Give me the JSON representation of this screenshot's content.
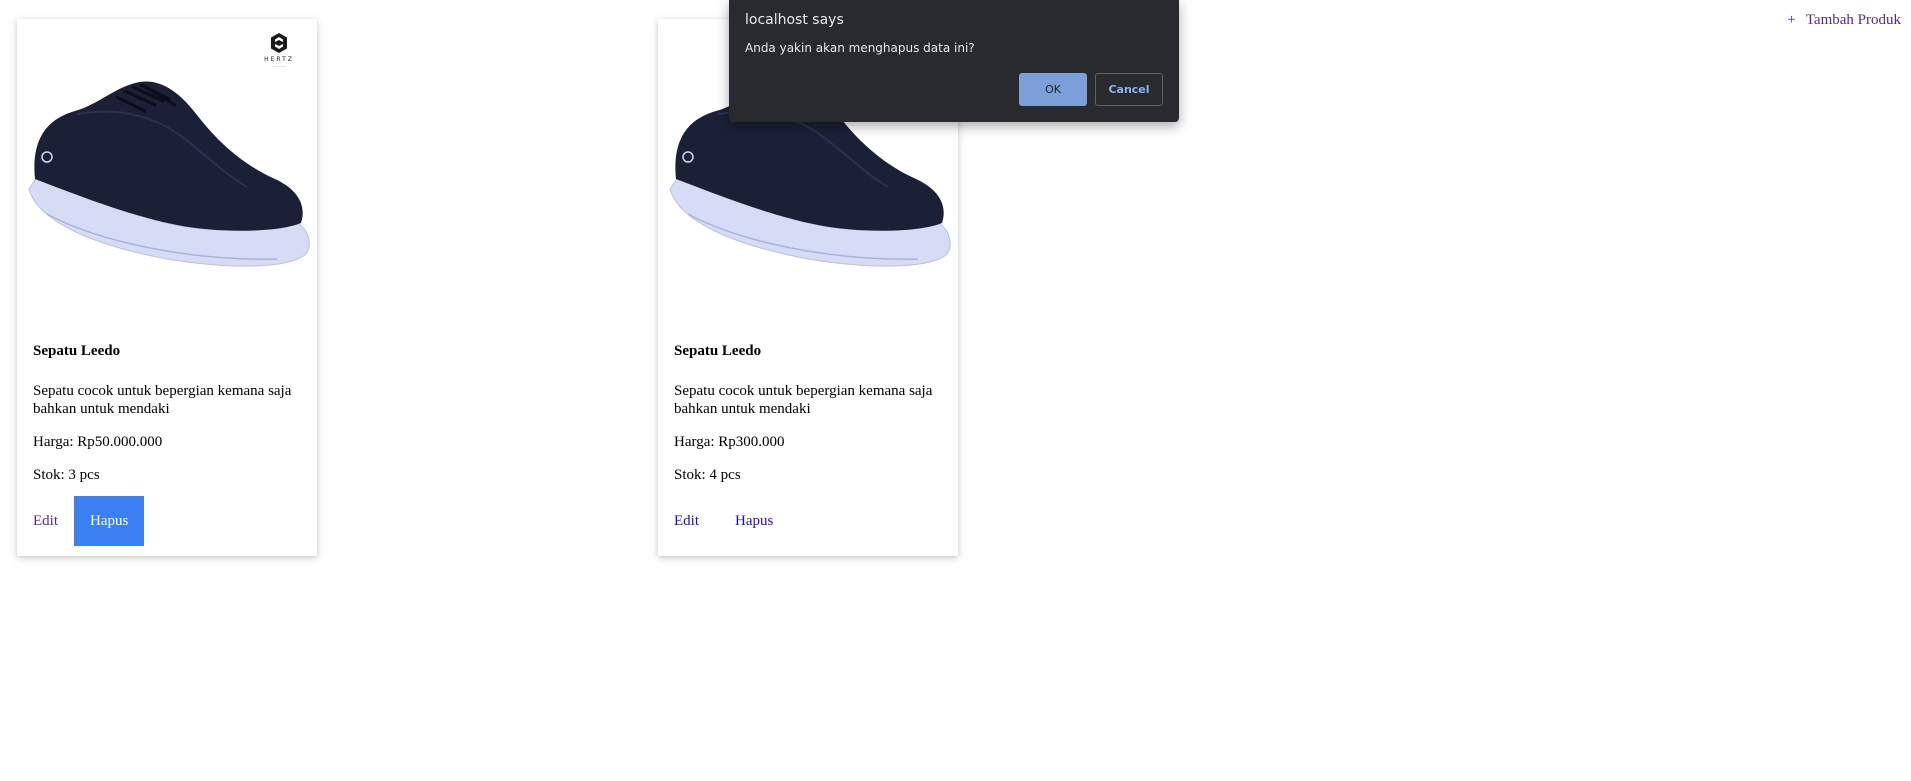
{
  "header": {
    "add_icon": "plus-icon",
    "add_symbol": "+",
    "add_label": "Tambah Produk"
  },
  "products": [
    {
      "image_icon": "sneaker-image",
      "brand": "HERTZ",
      "name": "Sepatu Leedo",
      "description": "Sepatu cocok untuk bepergian kemana saja bahkan untuk mendaki",
      "price": "Harga: Rp50.000.000",
      "stock": "Stok: 3 pcs",
      "edit_label": "Edit",
      "delete_label": "Hapus"
    },
    {
      "image_icon": "sneaker-image",
      "name": "Sepatu Leedo",
      "description": "Sepatu cocok untuk bepergian kemana saja bahkan untuk mendaki",
      "price": "Harga: Rp300.000",
      "stock": "Stok: 4 pcs",
      "edit_label": "Edit",
      "delete_label": "Hapus"
    }
  ],
  "dialog": {
    "title": "localhost says",
    "message": "Anda yakin akan menghapus data ini?",
    "ok_label": "OK",
    "cancel_label": "Cancel"
  },
  "colors": {
    "accent_blue": "#3b7ff2",
    "link_purple": "#5a2a82",
    "link_blue": "#1a0dcc",
    "dialog_bg": "#292a2d",
    "dialog_button": "#8ab4f8"
  }
}
